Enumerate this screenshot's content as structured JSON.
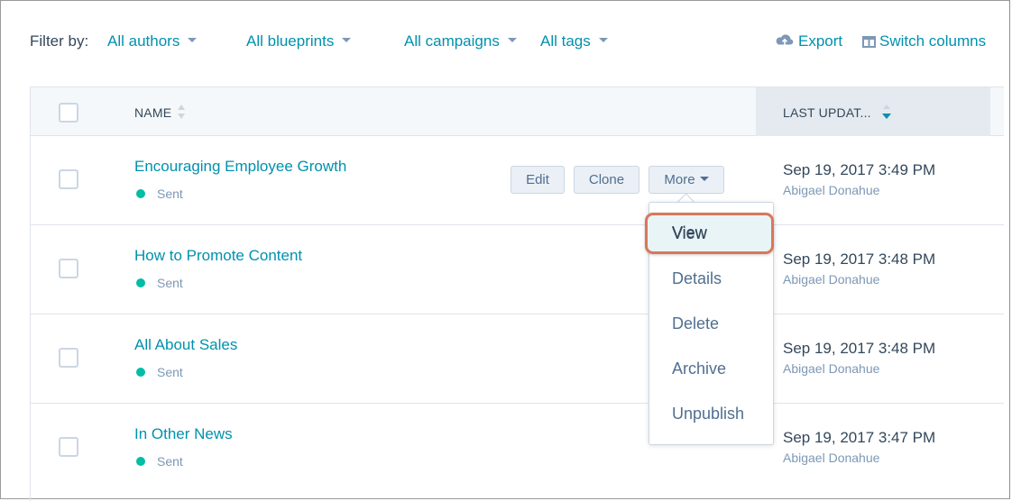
{
  "filter": {
    "label": "Filter by:",
    "authors": "All authors",
    "blueprints": "All blueprints",
    "campaigns": "All campaigns",
    "tags": "All tags"
  },
  "actions": {
    "export": "Export",
    "switch_columns": "Switch columns"
  },
  "table": {
    "columns": {
      "name": "NAME",
      "last_updated": "LAST UPDAT..."
    },
    "rows": [
      {
        "title": "Encouraging Employee Growth",
        "status": "Sent",
        "date": "Sep 19, 2017 3:49 PM",
        "author": "Abigael Donahue"
      },
      {
        "title": "How to Promote Content",
        "status": "Sent",
        "date": "Sep 19, 2017 3:48 PM",
        "author": "Abigael Donahue"
      },
      {
        "title": "All About Sales",
        "status": "Sent",
        "date": "Sep 19, 2017 3:48 PM",
        "author": "Abigael Donahue"
      },
      {
        "title": "In Other News",
        "status": "Sent",
        "date": "Sep 19, 2017 3:47 PM",
        "author": "Abigael Donahue"
      }
    ]
  },
  "row_actions": {
    "edit": "Edit",
    "clone": "Clone",
    "more": "More"
  },
  "more_menu": {
    "view": "View",
    "details": "Details",
    "delete": "Delete",
    "archive": "Archive",
    "unpublish": "Unpublish"
  },
  "icons": {
    "export": "cloud-upload-icon",
    "switch_columns": "columns-icon",
    "sort": "sort-icon",
    "status": "status-dot-icon"
  },
  "colors": {
    "link": "#0091ae",
    "status_sent": "#00bda5",
    "highlight_border": "#d9775a"
  }
}
